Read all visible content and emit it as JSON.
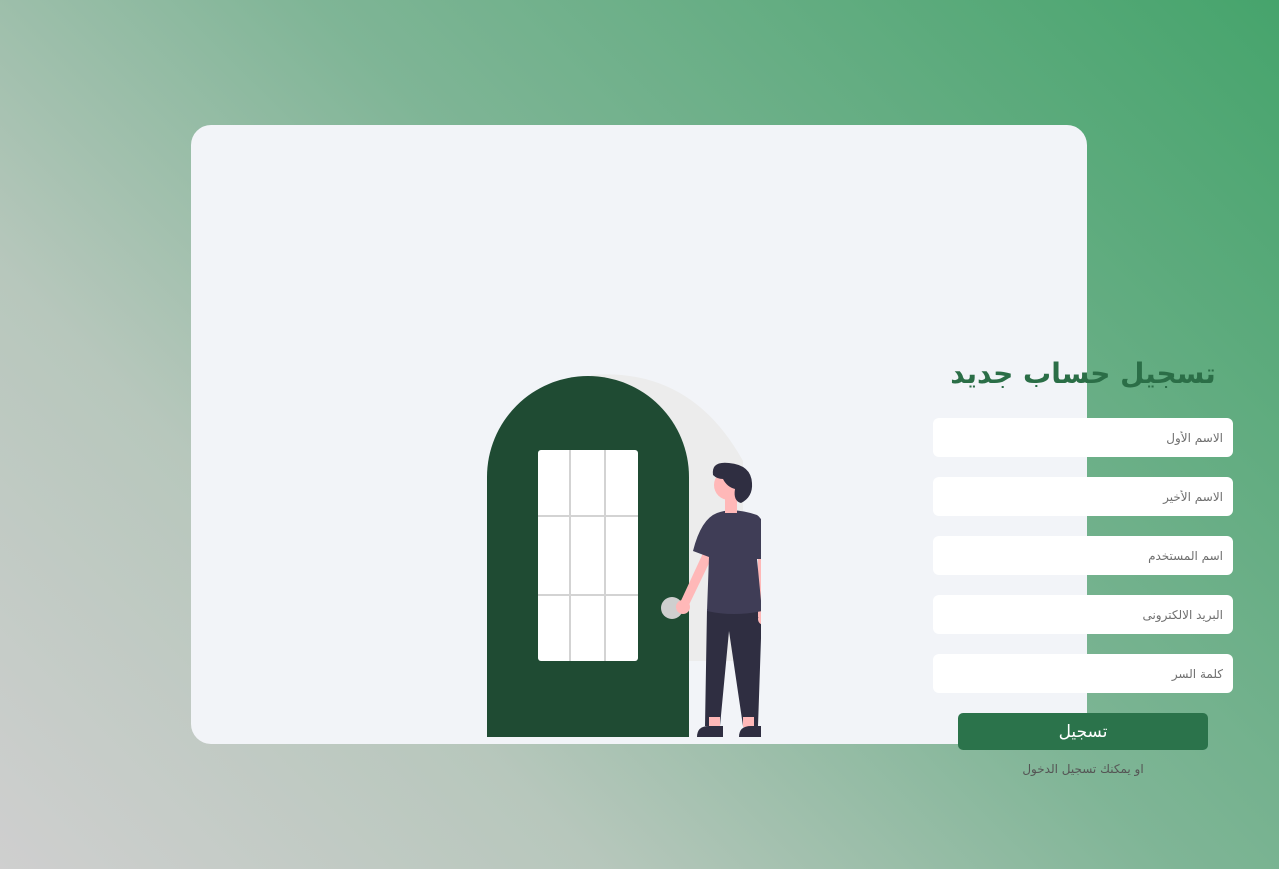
{
  "form": {
    "title": "تسجيل حساب جديد",
    "fields": [
      {
        "placeholder": "الاسم الأول",
        "value": ""
      },
      {
        "placeholder": "الاسم الأخير",
        "value": ""
      },
      {
        "placeholder": "اسم المستخدم",
        "value": ""
      },
      {
        "placeholder": "البريد الالكترونى",
        "value": ""
      },
      {
        "placeholder": "كلمة السر",
        "value": ""
      }
    ],
    "submit_label": "تسجيل",
    "login_link": "او يمكنك تسجيل الدخول"
  },
  "colors": {
    "accent": "#2b734b",
    "title": "#2b6e47",
    "door": "#1f4b33",
    "card": "#f2f4f8"
  },
  "illustration": {
    "icon": "person-at-door-illustration"
  }
}
